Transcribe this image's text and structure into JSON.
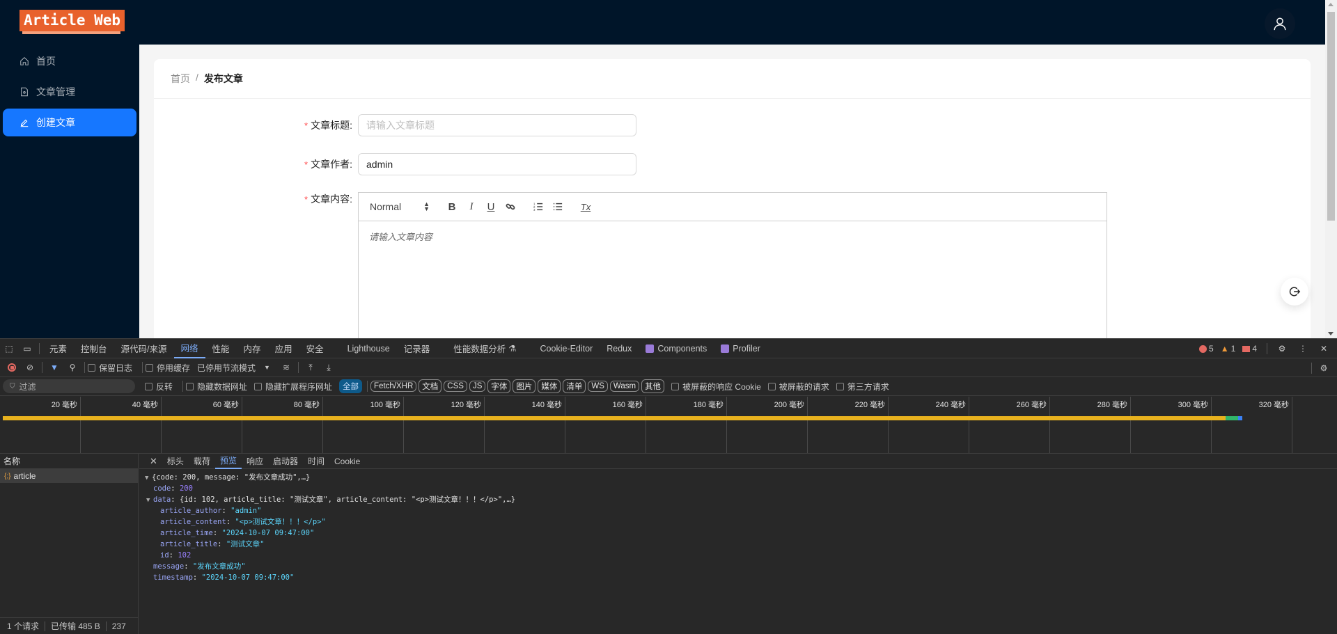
{
  "app": {
    "logo": "Article Web",
    "sidebar": {
      "items": [
        {
          "label": "首页",
          "icon": "home-icon",
          "active": false
        },
        {
          "label": "文章管理",
          "icon": "file-icon",
          "active": false
        },
        {
          "label": "创建文章",
          "icon": "edit-icon",
          "active": true
        }
      ]
    },
    "breadcrumb": {
      "home": "首页",
      "separator": "/",
      "current": "发布文章"
    },
    "form": {
      "title_label": "文章标题",
      "title_placeholder": "请输入文章标题",
      "title_value": "",
      "author_label": "文章作者",
      "author_value": "admin",
      "content_label": "文章内容",
      "content_placeholder": "请输入文章内容",
      "required_mark": "*",
      "colon": ":"
    },
    "editor_toolbar": {
      "heading_select": "Normal",
      "buttons": [
        "bold",
        "italic",
        "underline",
        "link",
        "ordered-list",
        "bullet-list",
        "clear-format"
      ],
      "bold": "B",
      "italic": "I",
      "underline": "U",
      "clear": "Tx"
    }
  },
  "devtools": {
    "tabs": [
      "元素",
      "控制台",
      "源代码/来源",
      "网络",
      "性能",
      "内存",
      "应用",
      "安全",
      "Lighthouse",
      "记录器",
      "性能数据分析",
      "Cookie-Editor",
      "Redux",
      "Components",
      "Profiler"
    ],
    "active_tab": "网络",
    "counts": {
      "errors": "5",
      "warnings": "1",
      "issues": "4"
    },
    "network_toolbar": {
      "preserve_log": "保留日志",
      "disable_cache": "停用缓存",
      "throttle": "已停用节流模式"
    },
    "filter_bar": {
      "filter_placeholder": "过滤",
      "invert": "反转",
      "hide_data_urls": "隐藏数据网址",
      "hide_ext_urls": "隐藏扩展程序网址",
      "types": [
        "全部",
        "Fetch/XHR",
        "文档",
        "CSS",
        "JS",
        "字体",
        "图片",
        "媒体",
        "清单",
        "WS",
        "Wasm",
        "其他"
      ],
      "active_type": "全部",
      "blocked_cookies": "被屏蔽的响应 Cookie",
      "blocked_requests": "被屏蔽的请求",
      "third_party": "第三方请求"
    },
    "timeline": {
      "ticks": [
        "20 毫秒",
        "40 毫秒",
        "60 毫秒",
        "80 毫秒",
        "100 毫秒",
        "120 毫秒",
        "140 毫秒",
        "160 毫秒",
        "180 毫秒",
        "200 毫秒",
        "220 毫秒",
        "240 毫秒",
        "260 毫秒",
        "280 毫秒",
        "300 毫秒",
        "320 毫秒"
      ],
      "colors": {
        "waiting": "#e8b21e",
        "download": "#31b56a",
        "end": "#3b82f6"
      }
    },
    "requests": {
      "header": "名称",
      "items": [
        {
          "name": "article",
          "icon": "json-icon"
        }
      ]
    },
    "detail_tabs": [
      "标头",
      "载荷",
      "预览",
      "响应",
      "启动器",
      "时间",
      "Cookie"
    ],
    "active_detail_tab": "预览",
    "preview": {
      "summary": "{code: 200, message: \"发布文章成功\",…}",
      "code_key": "code",
      "code_val": "200",
      "data_key": "data",
      "data_summary": "{id: 102, article_title: \"测试文章\", article_content: \"<p>测试文章！！！</p>\",…}",
      "fields": [
        {
          "key": "article_author",
          "value": "\"admin\"",
          "type": "string"
        },
        {
          "key": "article_content",
          "value": "\"<p>测试文章！！！</p>\"",
          "type": "string"
        },
        {
          "key": "article_time",
          "value": "\"2024-10-07 09:47:00\"",
          "type": "string"
        },
        {
          "key": "article_title",
          "value": "\"测试文章\"",
          "type": "string"
        },
        {
          "key": "id",
          "value": "102",
          "type": "number"
        }
      ],
      "message_key": "message",
      "message_val": "\"发布文章成功\"",
      "timestamp_key": "timestamp",
      "timestamp_val": "\"2024-10-07 09:47:00\""
    },
    "status": {
      "requests": "1 个请求",
      "transferred": "已传输 485 B",
      "extra": "237"
    }
  }
}
